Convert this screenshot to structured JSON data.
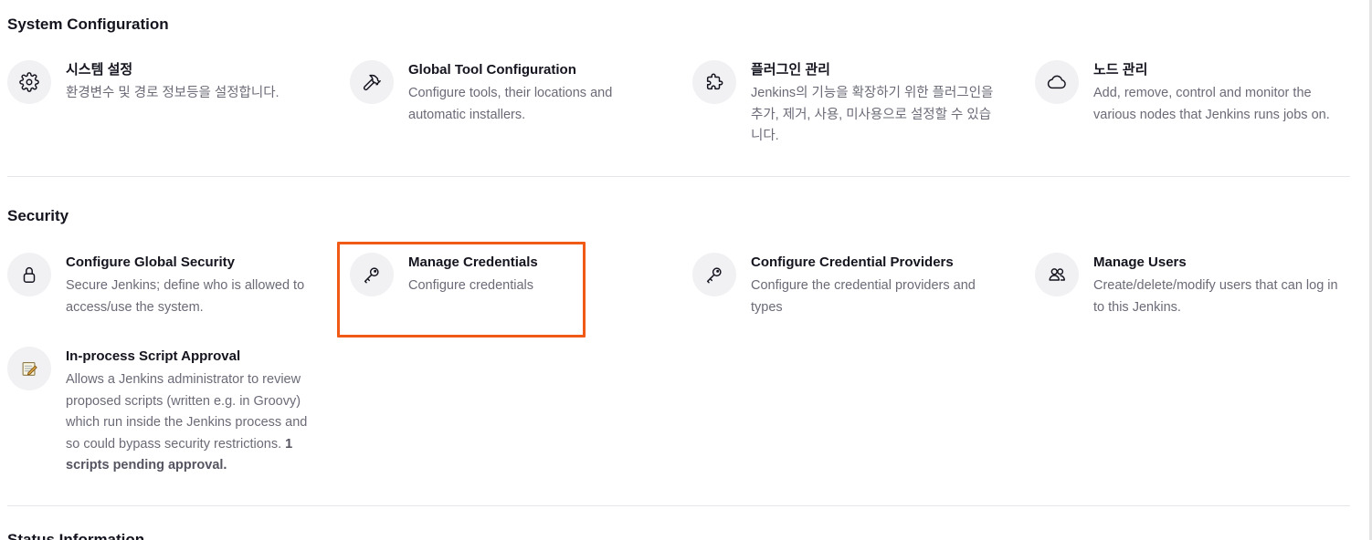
{
  "system_configuration": {
    "title": "System Configuration",
    "items": [
      {
        "icon": "gear-icon",
        "title": "시스템 설정",
        "desc": "환경변수 및 경로 정보등을 설정합니다."
      },
      {
        "icon": "hammer-icon",
        "title": "Global Tool Configuration",
        "desc": "Configure tools, their locations and automatic installers."
      },
      {
        "icon": "puzzle-icon",
        "title": "플러그인 관리",
        "desc": "Jenkins의 기능을 확장하기 위한 플러그인을 추가, 제거, 사용, 미사용으로 설정할 수 있습니다."
      },
      {
        "icon": "cloud-icon",
        "title": "노드 관리",
        "desc": "Add, remove, control and monitor the various nodes that Jenkins runs jobs on."
      }
    ]
  },
  "security": {
    "title": "Security",
    "items": [
      {
        "icon": "lock-icon",
        "title": "Configure Global Security",
        "desc": "Secure Jenkins; define who is allowed to access/use the system."
      },
      {
        "icon": "key-icon",
        "title": "Manage Credentials",
        "desc": "Configure credentials"
      },
      {
        "icon": "key-icon",
        "title": "Configure Credential Providers",
        "desc": "Configure the credential providers and types"
      },
      {
        "icon": "users-icon",
        "title": "Manage Users",
        "desc": "Create/delete/modify users that can log in to this Jenkins."
      },
      {
        "icon": "notepad-pencil-icon",
        "title": "In-process Script Approval",
        "desc": "Allows a Jenkins administrator to review proposed scripts (written e.g. in Groovy) which run inside the Jenkins process and so could bypass security restrictions.",
        "desc_bold": "1 scripts pending approval."
      }
    ]
  },
  "status_information": {
    "title": "Status Information"
  },
  "colors": {
    "highlight": "#f15a16",
    "icon_bg": "#f1f1f4",
    "desc_text": "#6b6b78"
  }
}
